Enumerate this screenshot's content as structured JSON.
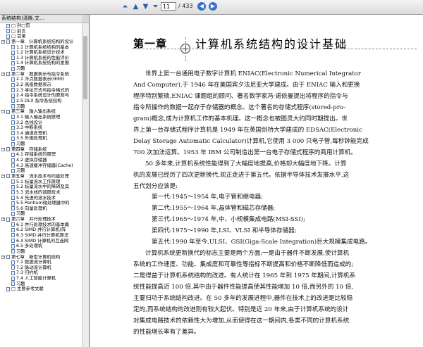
{
  "toolbar": {
    "page_value": "11",
    "page_total": "/ 433",
    "nav_icons": [
      "first-page-icon",
      "previous-page-icon",
      "next-page-icon",
      "last-page-icon"
    ],
    "go_icons": [
      "go-back-icon",
      "go-forward-icon"
    ]
  },
  "sidebar": {
    "title": "系统结构)清晰.文...",
    "items": [
      {
        "level": 0,
        "exp": "",
        "label": "□ 封□页"
      },
      {
        "level": 0,
        "exp": "",
        "label": "□ 前言"
      },
      {
        "level": 0,
        "exp": "",
        "label": "□ 目录"
      },
      {
        "level": 0,
        "exp": "−",
        "label": "第一章　计算机系统结构的设计"
      },
      {
        "level": 1,
        "exp": "",
        "label": "1.1 计算机系统结构的基本"
      },
      {
        "level": 1,
        "exp": "",
        "label": "1.2 计算机系统设计技术"
      },
      {
        "level": 1,
        "exp": "",
        "label": "1.3 计算机系统的性能评价"
      },
      {
        "level": 1,
        "exp": "",
        "label": "1.4 计算机系统结构的发展"
      },
      {
        "level": 1,
        "exp": "",
        "label": "习题"
      },
      {
        "level": 0,
        "exp": "−",
        "label": "第二章　数据表示与指令系统"
      },
      {
        "level": 1,
        "exp": "",
        "label": "2.1 浮点数据表示(IEEE)"
      },
      {
        "level": 1,
        "exp": "",
        "label": "2.2 高级数据表示"
      },
      {
        "level": 1,
        "exp": "",
        "label": "2.3 寻址方式与指令格式的"
      },
      {
        "level": 1,
        "exp": "",
        "label": "2.4 指令系统设计的原则与"
      },
      {
        "level": 1,
        "exp": "",
        "label": "2.5 DLX 指令系统结构"
      },
      {
        "level": 1,
        "exp": "",
        "label": "习题"
      },
      {
        "level": 0,
        "exp": "−",
        "label": "第三章　输入输出系统"
      },
      {
        "level": 1,
        "exp": "",
        "label": "3.1 输入输出系统原理"
      },
      {
        "level": 1,
        "exp": "",
        "label": "3.2 总线设计"
      },
      {
        "level": 1,
        "exp": "",
        "label": "3.3 中断系统"
      },
      {
        "level": 1,
        "exp": "",
        "label": "3.4 通道处理机"
      },
      {
        "level": 1,
        "exp": "",
        "label": "3.5 外围处理机"
      },
      {
        "level": 1,
        "exp": "",
        "label": "习题"
      },
      {
        "level": 0,
        "exp": "−",
        "label": "第四章　存储系统"
      },
      {
        "level": 1,
        "exp": "",
        "label": "4.1 存储系统的原理"
      },
      {
        "level": 1,
        "exp": "",
        "label": "4.2 虚拟存储器"
      },
      {
        "level": 1,
        "exp": "",
        "label": "4.3 高速缓冲存储器(Cache)"
      },
      {
        "level": 1,
        "exp": "",
        "label": "习题"
      },
      {
        "level": 0,
        "exp": "−",
        "label": "第五章　流水技术与向量处理"
      },
      {
        "level": 1,
        "exp": "",
        "label": "5.1 标量流水工作原理"
      },
      {
        "level": 1,
        "exp": "",
        "label": "5.2 标量流水中的障碍及其"
      },
      {
        "level": 1,
        "exp": "",
        "label": "5.3 流水线的调度技术"
      },
      {
        "level": 1,
        "exp": "",
        "label": "5.4 先进的流水技术"
      },
      {
        "level": 1,
        "exp": "",
        "label": "5.5 Pentium微处理器中的"
      },
      {
        "level": 1,
        "exp": "",
        "label": "5.6 向量处理机"
      },
      {
        "level": 1,
        "exp": "",
        "label": "习题"
      },
      {
        "level": 0,
        "exp": "−",
        "label": "第六章　并行处理技术"
      },
      {
        "level": 1,
        "exp": "",
        "label": "6.1 并行处理技术的基本概"
      },
      {
        "level": 1,
        "exp": "",
        "label": "6.2 SIMD 并行计算机(阵"
      },
      {
        "level": 1,
        "exp": "",
        "label": "6.3 SIMD 并行计算机算法"
      },
      {
        "level": 1,
        "exp": "",
        "label": "6.4 SIMD 计算机的互连网"
      },
      {
        "level": 1,
        "exp": "",
        "label": "6.5 多处理机"
      },
      {
        "level": 1,
        "exp": "",
        "label": "习题"
      },
      {
        "level": 0,
        "exp": "−",
        "label": "第七章　新型计算机结构"
      },
      {
        "level": 1,
        "exp": "",
        "label": "7.1 数据流计算机"
      },
      {
        "level": 1,
        "exp": "",
        "label": "7.2 脉动流计算机"
      },
      {
        "level": 1,
        "exp": "",
        "label": "7.3 归约机"
      },
      {
        "level": 1,
        "exp": "",
        "label": "7.4 人工智能计算机"
      },
      {
        "level": 1,
        "exp": "",
        "label": "习题"
      },
      {
        "level": 0,
        "exp": "",
        "label": "□ 主要参考文献"
      }
    ]
  },
  "document": {
    "chapter_number": "第一章",
    "chapter_title": "计算机系统结构的设计基础",
    "lines": [
      {
        "cls": "ind",
        "text": "世界上第一台通用电子数字计算机 ENIAC(Electronic Numerical Integrator"
      },
      {
        "cls": "",
        "text": "And Computer),于 1946 年在美国宾夕法尼亚大学建成。由于 ENIAC 输入和更换"
      },
      {
        "cls": "",
        "text": "程序特别繁琐,ENIAC 课题组的顾问、著名数学家冯·诺依曼提出将程序的指令与"
      },
      {
        "cls": "",
        "text": "指令所操作的数据一起存于存储器的概念。这个著名的存储式程序(stored-pro-"
      },
      {
        "cls": "",
        "text": "gram)概念,成为计算机工作的基本机理。这一概念也被图灵大约同时期提出。世"
      },
      {
        "cls": "",
        "text": "界上第一台存储式程序计算机是 1949 年在英国剑桥大学建成的 EDSAC(Electronic"
      },
      {
        "cls": "",
        "text": "Delay Storage Automatic Calculator)计算机,它使用 3 000 只电子管,每秒钟能完成"
      },
      {
        "cls": "",
        "text": "700 次加法运算。1953 年 IBM 公司制造出第一台电子存储式程序的商用计算机。"
      },
      {
        "cls": "ind",
        "text": "50 多年来,计算机系统性能得到了大幅度地提高,价格却大幅度地下降。计算"
      },
      {
        "cls": "",
        "text": "机的发展已经历了四次更新换代,现正走进于第五代。依据半导体技术发展水平,这"
      },
      {
        "cls": "",
        "text": "五代划分应该是:"
      },
      {
        "cls": "ind2",
        "text": "第一代:1945～1954 年,电子管和继电器;"
      },
      {
        "cls": "ind2",
        "text": "第二代:1955～1964 年,晶体管和磁芯存储器;"
      },
      {
        "cls": "ind2",
        "text": "第三代:1965～1974 年,中、小规模集成电路(MSI-SSI);"
      },
      {
        "cls": "ind2",
        "text": "第四代:1975～1990 年,LSI、VLSI 和半导体存储器;"
      },
      {
        "cls": "ind2",
        "text": "第五代:1990 年至今,ULSI、GSI(Giga-Scale Integration)巨大规模集成电路。"
      },
      {
        "cls": "ind",
        "text": "计算机系统更新换代的标志主要是两个方面:一是由于器件不断发展,使计算机"
      },
      {
        "cls": "",
        "text": "系统的工作速度、功能、集成度和可靠性等指标不断提高和价格不断降低而造成的;"
      },
      {
        "cls": "",
        "text": "二是得益于计算机系统结构的改进。有人统计在 1965 年到 1975 年期间,计算机系"
      },
      {
        "cls": "",
        "text": "统性能提高近 100 倍,其中由于器件性能提高使其性能增加 10 倍,而另外的 10 倍,"
      },
      {
        "cls": "",
        "text": "主要归功于系统结构改进。在 50 多年的发展进程中,器件在技术上的改进是比较稳"
      },
      {
        "cls": "",
        "text": "定的,而系统结构的改进则有较大起伏。特别是近 20 年来,由于计算机系统的设计"
      },
      {
        "cls": "",
        "text": "对集成电路技术的依赖性大为增加,从而使得在这一期间内,各类不同的计算机系统"
      },
      {
        "cls": "",
        "text": "的性能增长率有了差异。"
      }
    ]
  }
}
